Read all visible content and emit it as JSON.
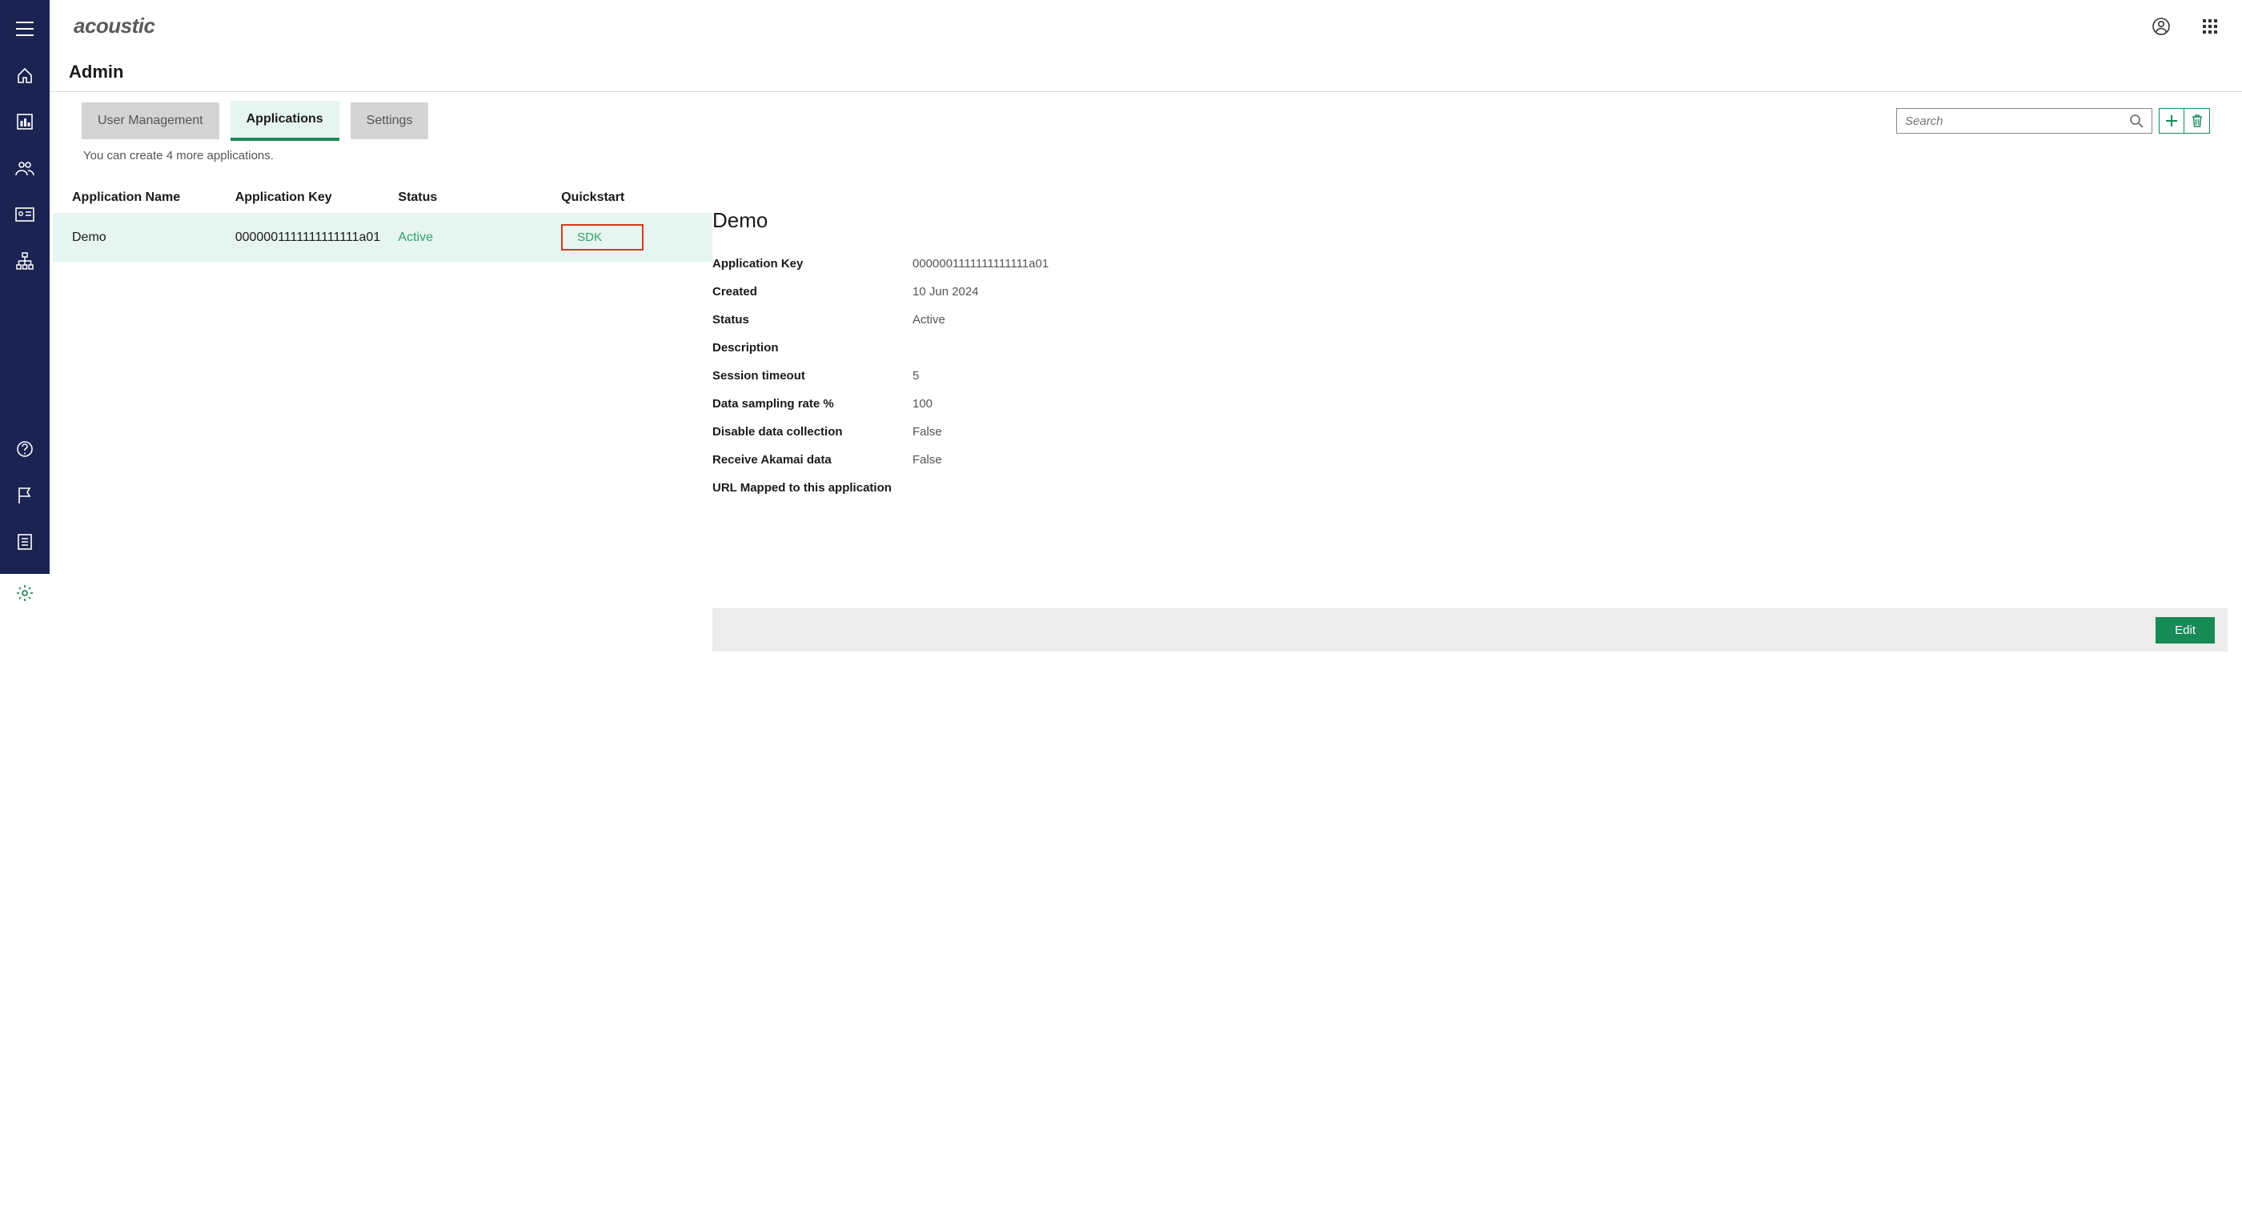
{
  "brand": "acoustic",
  "page_title": "Admin",
  "tabs": {
    "user_mgmt": "User Management",
    "applications": "Applications",
    "settings": "Settings"
  },
  "search": {
    "placeholder": "Search"
  },
  "helper": "You can create 4 more applications.",
  "table": {
    "headers": {
      "name": "Application Name",
      "key": "Application Key",
      "status": "Status",
      "quick": "Quickstart"
    },
    "rows": [
      {
        "name": "Demo",
        "key": "0000001111111111111a01",
        "status": "Active",
        "quick": "SDK"
      }
    ]
  },
  "detail": {
    "title": "Demo",
    "fields": {
      "app_key_label": "Application Key",
      "app_key_value": "0000001111111111111a01",
      "created_label": "Created",
      "created_value": "10 Jun 2024",
      "status_label": "Status",
      "status_value": "Active",
      "description_label": "Description",
      "description_value": "",
      "session_timeout_label": "Session timeout",
      "session_timeout_value": "5",
      "sampling_label": "Data sampling rate %",
      "sampling_value": "100",
      "disable_label": "Disable data collection",
      "disable_value": "False",
      "akamai_label": "Receive Akamai data",
      "akamai_value": "False",
      "url_label": "URL Mapped to this application",
      "url_value": ""
    }
  },
  "buttons": {
    "edit": "Edit"
  }
}
